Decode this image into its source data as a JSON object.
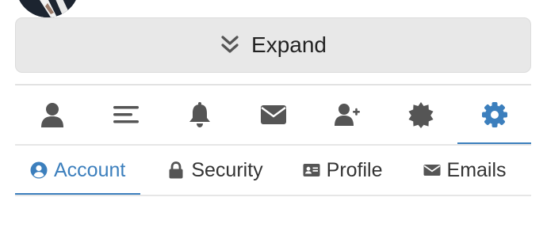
{
  "expand": {
    "label": "Expand",
    "icon": "chevron-double-down-icon"
  },
  "icon_tabs": [
    {
      "icon": "user-icon",
      "active": false
    },
    {
      "icon": "list-icon",
      "active": false
    },
    {
      "icon": "bell-icon",
      "active": false
    },
    {
      "icon": "envelope-icon",
      "active": false
    },
    {
      "icon": "user-plus-icon",
      "active": false
    },
    {
      "icon": "badge-icon",
      "active": false
    },
    {
      "icon": "gear-icon",
      "active": true
    }
  ],
  "text_tabs": [
    {
      "label": "Account",
      "icon": "user-circle-icon",
      "active": true
    },
    {
      "label": "Security",
      "icon": "lock-icon",
      "active": false
    },
    {
      "label": "Profile",
      "icon": "id-card-icon",
      "active": false
    },
    {
      "label": "Emails",
      "icon": "envelope-icon",
      "active": false
    }
  ],
  "colors": {
    "accent": "#3c7fbd",
    "icon_gray": "#555555",
    "button_bg": "#e8e8e8"
  }
}
